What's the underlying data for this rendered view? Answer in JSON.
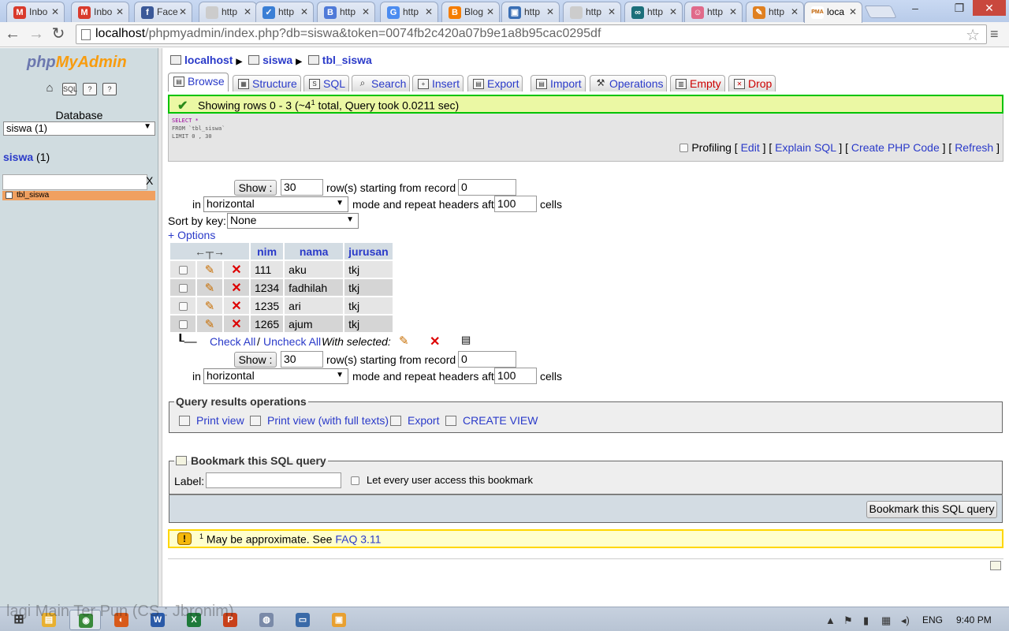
{
  "browser": {
    "tabs": [
      {
        "title": "Inbo",
        "icon": "gmail-icon",
        "color": "#d93a2c",
        "glyph": "M"
      },
      {
        "title": "Inbo",
        "icon": "gmail-icon",
        "color": "#d93a2c",
        "glyph": "M"
      },
      {
        "title": "Face",
        "icon": "facebook-icon",
        "color": "#3b5998",
        "glyph": "f"
      },
      {
        "title": "http",
        "icon": "page-icon",
        "color": "#cccccc",
        "glyph": ""
      },
      {
        "title": "http",
        "icon": "check-icon",
        "color": "#3a7fd5",
        "glyph": "✓"
      },
      {
        "title": "http",
        "icon": "b-icon",
        "color": "#4f7ad8",
        "glyph": "B"
      },
      {
        "title": "http",
        "icon": "google-icon",
        "color": "#4b8cf0",
        "glyph": "G"
      },
      {
        "title": "Blog",
        "icon": "blogger-icon",
        "color": "#f57d00",
        "glyph": "B"
      },
      {
        "title": "http",
        "icon": "web-icon",
        "color": "#3a6fb5",
        "glyph": "▣"
      },
      {
        "title": "http",
        "icon": "page-icon",
        "color": "#cccccc",
        "glyph": ""
      },
      {
        "title": "http",
        "icon": "loop-icon",
        "color": "#1b6f7a",
        "glyph": "∞"
      },
      {
        "title": "http",
        "icon": "avatar-icon",
        "color": "#e06a8a",
        "glyph": "☺"
      },
      {
        "title": "http",
        "icon": "pen-icon",
        "color": "#e08020",
        "glyph": "✎"
      },
      {
        "title": "loca",
        "icon": "pma-icon",
        "color": "#ffffff",
        "glyph": "PMA"
      }
    ],
    "url_host": "localhost",
    "url_path": "/phpmyadmin/index.php?db=siswa&token=0074fb2c420a07b9e1a8b95cac0295df"
  },
  "left": {
    "logo_php": "php",
    "logo_my": "My",
    "logo_admin": "Admin",
    "db_label": "Database",
    "db_selected": "siswa (1)",
    "db_name": "siswa",
    "db_count": "(1)",
    "filter_clear": "X",
    "table_item": "tbl_siswa"
  },
  "main": {
    "breadcrumb": {
      "server": "localhost",
      "db": "siswa",
      "table": "tbl_siswa"
    },
    "tabs": [
      {
        "label": "Browse",
        "icon": "browse-icon"
      },
      {
        "label": "Structure",
        "icon": "structure-icon"
      },
      {
        "label": "SQL",
        "icon": "sql-icon"
      },
      {
        "label": "Search",
        "icon": "search-icon"
      },
      {
        "label": "Insert",
        "icon": "insert-icon"
      },
      {
        "label": "Export",
        "icon": "export-icon"
      },
      {
        "label": "Import",
        "icon": "import-icon"
      },
      {
        "label": "Operations",
        "icon": "operations-icon"
      },
      {
        "label": "Empty",
        "icon": "empty-icon"
      },
      {
        "label": "Drop",
        "icon": "drop-icon"
      }
    ],
    "success_prefix": "Showing rows 0 - 3 (~4",
    "success_sup": "1",
    "success_suffix": " total, Query took 0.0211 sec)",
    "sql": {
      "line1": "SELECT *",
      "line2": "FROM `tbl_siswa`",
      "line3": "LIMIT 0 , 30"
    },
    "sql_links": {
      "profiling": "Profiling",
      "edit": "Edit",
      "explain": "Explain SQL",
      "php": "Create PHP Code",
      "refresh": "Refresh"
    },
    "nav": {
      "show": "Show :",
      "rows": "30",
      "rows_text": "row(s) starting from record #",
      "start": "0",
      "in": "in",
      "mode": "horizontal",
      "mode_text": "mode and repeat headers after",
      "repeat": "100",
      "cells": "cells"
    },
    "sort_label": "Sort by key:",
    "sort_value": "None",
    "options": "+ Options",
    "table": {
      "columns": [
        "nim",
        "nama",
        "jurusan"
      ],
      "rows": [
        [
          "111",
          "aku",
          "tkj"
        ],
        [
          "1234",
          "fadhilah",
          "tkj"
        ],
        [
          "1235",
          "ari",
          "tkj"
        ],
        [
          "1265",
          "ajum",
          "tkj"
        ]
      ]
    },
    "check_all": "Check All",
    "slash": "/",
    "uncheck_all": "Uncheck All",
    "with_selected": "With selected:",
    "qro": {
      "legend": "Query results operations",
      "print": "Print view",
      "print_full": "Print view (with full texts)",
      "export": "Export",
      "create_view": "CREATE VIEW"
    },
    "bookmark": {
      "legend": "Bookmark this SQL query",
      "label": "Label:",
      "label_value": "",
      "public": "Let every user access this bookmark",
      "button": "Bookmark this SQL query"
    },
    "notice": {
      "sup": "1",
      "text": "May be approximate. See ",
      "link": "FAQ 3.11"
    }
  },
  "taskbar": {
    "lang": "ENG",
    "clock": "9:40 PM",
    "watermark": "lagi Main Ter Pun (CS : Jbronim)",
    "apps": [
      {
        "icon": "explorer-icon",
        "color": "#e8b030",
        "glyph": "▤"
      },
      {
        "icon": "chrome-icon",
        "color": "#3a8a3a",
        "glyph": "◉"
      },
      {
        "icon": "firefox-icon",
        "color": "#d85a1a",
        "glyph": "◐"
      },
      {
        "icon": "word-icon",
        "color": "#2a5aa8",
        "glyph": "W"
      },
      {
        "icon": "excel-icon",
        "color": "#1e7a3a",
        "glyph": "X"
      },
      {
        "icon": "powerpoint-icon",
        "color": "#c8401a",
        "glyph": "P"
      },
      {
        "icon": "app-icon",
        "color": "#7a8aa8",
        "glyph": "◍"
      },
      {
        "icon": "remote-icon",
        "color": "#3a6aa8",
        "glyph": "▭"
      },
      {
        "icon": "folder-icon",
        "color": "#e8a030",
        "glyph": "▣"
      }
    ]
  }
}
